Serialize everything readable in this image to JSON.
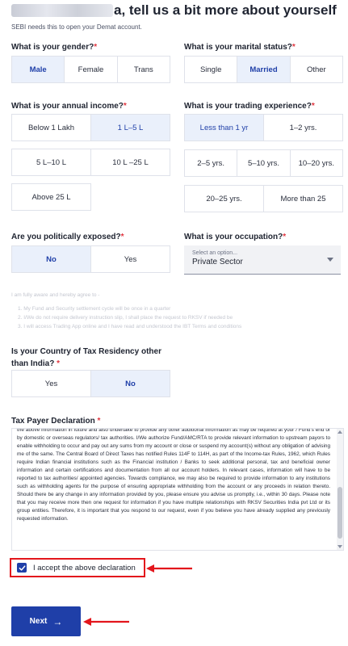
{
  "header": {
    "title_suffix": "a, tell us a bit more about yourself",
    "subtitle": "SEBI needs this to open your Demat account."
  },
  "gender": {
    "label": "What is your gender?",
    "required": "*",
    "options": [
      "Male",
      "Female",
      "Trans"
    ],
    "selected": "Male"
  },
  "marital_status": {
    "label": "What is your marital status?",
    "required": "*",
    "options": [
      "Single",
      "Married",
      "Other"
    ],
    "selected": "Married"
  },
  "income": {
    "label": "What is your annual income?",
    "required": "*",
    "options": [
      "Below 1 Lakh",
      "1 L–5 L",
      "5 L–10 L",
      "10 L –25 L",
      "Above 25 L"
    ],
    "selected": "1 L–5 L"
  },
  "trading_experience": {
    "label": "What is your trading experience?",
    "required": "*",
    "options": [
      "Less than 1 yr",
      "1–2 yrs.",
      "2–5 yrs.",
      "5–10 yrs.",
      "10–20 yrs.",
      "20–25 yrs.",
      "More than 25"
    ],
    "selected": "Less than 1 yr"
  },
  "politically_exposed": {
    "label": "Are you politically exposed?",
    "required": "*",
    "options": [
      "No",
      "Yes"
    ],
    "selected": "No"
  },
  "occupation": {
    "label": "What is your occupation?",
    "required": "*",
    "placeholder": "Select an option...",
    "value": "Private Sector"
  },
  "terms": {
    "intro": "I am fully aware and hereby agree to -",
    "items": [
      "1. My Fund and Security settlement cycle will be once in a quarter",
      "2. I/We do not require delivery instruction slip, I shall place the request to RKSV if needed be",
      "3. I will access Trading App online and I have read and understood the IBT Terms and conditions"
    ]
  },
  "tax_residency": {
    "label_line1": "Is your Country of Tax Residency other",
    "label_line2": "than India?",
    "required": "*",
    "options": [
      "Yes",
      "No"
    ],
    "selected": "No"
  },
  "tax_declaration": {
    "label": "Tax Payer Declaration",
    "required": "*",
    "text": "the above information in future and also undertake to provide any other additional information as may be required at your / Fund's end or by domestic or overseas regulators/ tax authorities. I/We authorize Fund/AMC/RTA to provide relevant information to upstream payors to enable withholding to occur and pay out any sums from my account or close or suspend my account(s) without any obligation of advising me of the same. The Central Board of Direct Taxes has notified Rules 114F to 114H, as part of the Income-tax Rules, 1962, which Rules require Indian financial institutions such as the Financial institution / Banks to seek additional personal, tax and beneficial owner information and certain certifications and documentation from all our account holders. In relevant cases, information will have to be reported to tax authorities/ appointed agencies. Towards compliance, we may also be required to provide information to any institutions such as withholding agents for the purpose of ensuring appropriate withholding from the account or any proceeds in relation thereto. Should there be any change in any information provided by you, please ensure you advise us promptly, i.e., within 30 days. Please note that you may receive more then one request for information if you have multiple relationships with RKSV Securities India pvt Ltd or its group entities. Therefore, it is important that you respond to our request, even if you believe you have already supplied any previously requested information."
  },
  "accept": {
    "label": "I accept the above declaration",
    "checked": true
  },
  "next_button": {
    "label": "Next",
    "arrow": "→"
  },
  "colors": {
    "accent": "#1f3fa8",
    "selected_bg": "#eaf0fb",
    "annotation_red": "#e3161c",
    "required": "#e0353f"
  }
}
